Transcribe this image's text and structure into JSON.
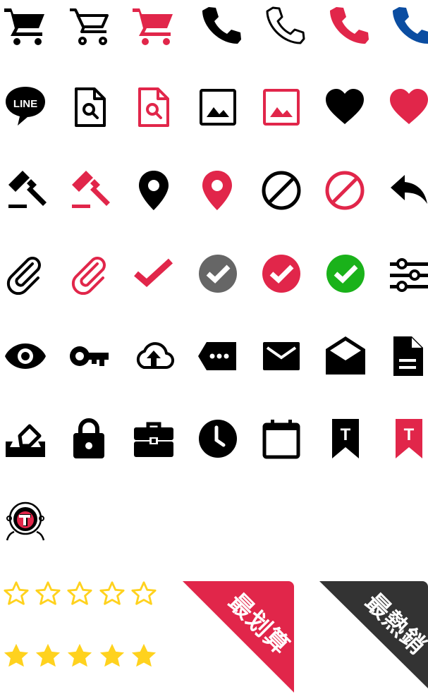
{
  "colors": {
    "black": "#000000",
    "red": "#E1264A",
    "blue": "#0B4DA1",
    "grey": "#666666",
    "green": "#1AB21A",
    "gold": "#FFD21E",
    "dark": "#333333"
  },
  "icons": [
    "cart-icon",
    "cart-outline-icon",
    "cart-red-icon",
    "phone-icon",
    "phone-outline-icon",
    "phone-red-icon",
    "phone-blue-icon",
    "line-icon",
    "file-search-icon",
    "file-search-red-icon",
    "image-icon",
    "image-red-icon",
    "heart-icon",
    "heart-red-icon",
    "gavel-icon",
    "gavel-red-icon",
    "map-pin-icon",
    "map-pin-red-icon",
    "prohibited-icon",
    "prohibited-red-icon",
    "reply-icon",
    "paperclip-icon",
    "paperclip-red-icon",
    "check-red-icon",
    "check-circle-grey-icon",
    "check-circle-red-icon",
    "check-circle-green-icon",
    "sliders-icon",
    "eye-icon",
    "key-icon",
    "cloud-upload-icon",
    "tag-more-icon",
    "mail-icon",
    "mail-open-icon",
    "document-icon",
    "eraser-icon",
    "lock-icon",
    "briefcase-icon",
    "clock-icon",
    "calendar-icon",
    "bookmark-t-icon",
    "bookmark-t-red-icon",
    "astronaut-logo-icon"
  ],
  "line_logo_text": "LINE",
  "bookmark_letter": "T",
  "stars": {
    "outline_count": 5,
    "filled_count": 5
  },
  "ribbons": {
    "best_deal": {
      "text": "最划算",
      "color": "#E1264A"
    },
    "best_seller": {
      "text": "最熱銷",
      "color": "#333333"
    }
  }
}
